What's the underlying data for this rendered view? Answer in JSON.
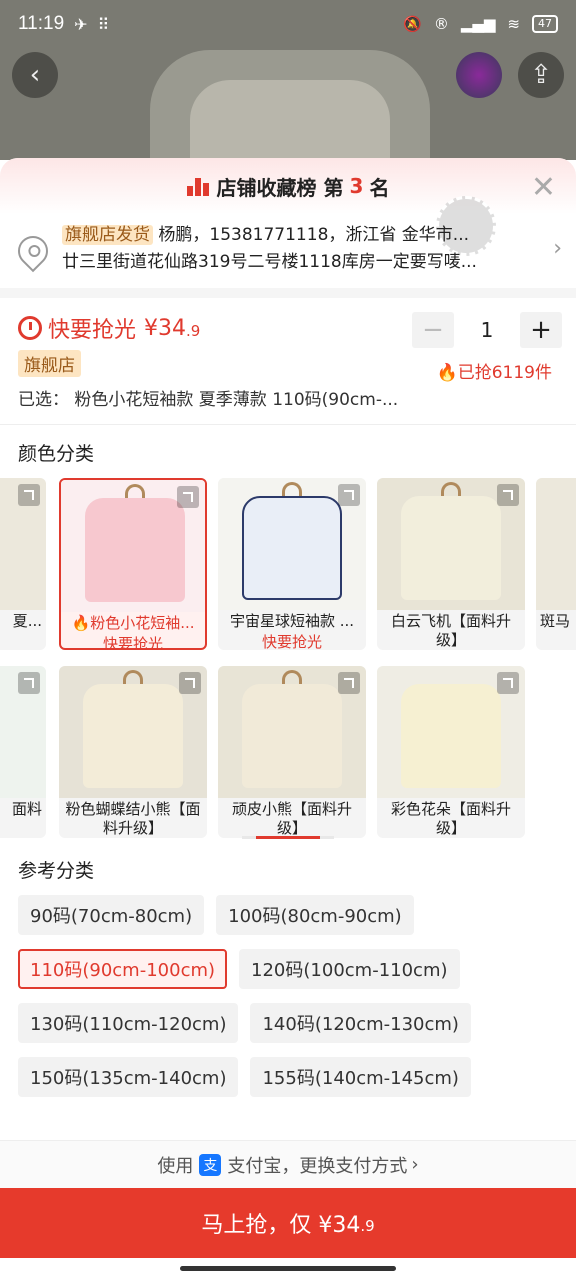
{
  "status_bar": {
    "time": "11:19",
    "battery": "47"
  },
  "banner": {
    "prefix": "店铺收藏榜 第",
    "rank": "3",
    "suffix": "名"
  },
  "address": {
    "tag": "旗舰店发货",
    "line1": "杨鹏，15381771118，浙江省 金华市...",
    "line2": "廿三里街道花仙路319号二号楼1118库房一定要写唛..."
  },
  "price": {
    "label": "快要抢光",
    "currency": "¥",
    "main": "34",
    "decimal": ".9",
    "store_tag": "旗舰店",
    "selected": "已选： 粉色小花短袖款 夏季薄款 110码(90cm-..."
  },
  "stepper": {
    "minus": "−",
    "qty": "1",
    "plus": "+"
  },
  "sold": "已抢6119件",
  "color_section": {
    "title": "颜色分类",
    "row1": [
      {
        "label": "夏...",
        "hot": ""
      },
      {
        "label": "粉色小花短袖...",
        "hot": "快要抢光",
        "selected": true,
        "color": "#f7c8cf"
      },
      {
        "label": "宇宙星球短袖款 ...",
        "hot": "快要抢光",
        "color": "#e9eef7"
      },
      {
        "label": "白云飞机【面料升级】",
        "hot": "",
        "color": "#f2eedc"
      },
      {
        "label": "斑马",
        "hot": ""
      }
    ],
    "row2": [
      {
        "label": "面料",
        "hot": ""
      },
      {
        "label": "粉色蝴蝶结小熊【面料升级】",
        "hot": "",
        "color": "#f3ecd8"
      },
      {
        "label": "顽皮小熊【面料升级】",
        "hot": "",
        "color": "#f1ead8"
      },
      {
        "label": "彩色花朵【面料升级】",
        "hot": "",
        "color": "#f6f0d2"
      }
    ]
  },
  "size_section": {
    "title": "参考分类",
    "rows": [
      [
        "90码(70cm-80cm)",
        "100码(80cm-90cm)"
      ],
      [
        "110码(90cm-100cm)",
        "120码(100cm-110cm)"
      ],
      [
        "130码(110cm-120cm)",
        "140码(120cm-130cm)"
      ],
      [
        "150码(135cm-140cm)",
        "155码(140cm-145cm)"
      ]
    ],
    "selected": "110码(90cm-100cm)"
  },
  "payment": {
    "prefix": "使用",
    "icon_text": "支",
    "text": "支付宝，更换支付方式",
    "chevron": "›"
  },
  "buy_button": {
    "label": "马上抢，仅 ¥34",
    "decimal": ".9"
  },
  "colors": {
    "accent": "#e03a2e",
    "tag_bg": "#fde5c2",
    "alipay": "#1677ff"
  }
}
